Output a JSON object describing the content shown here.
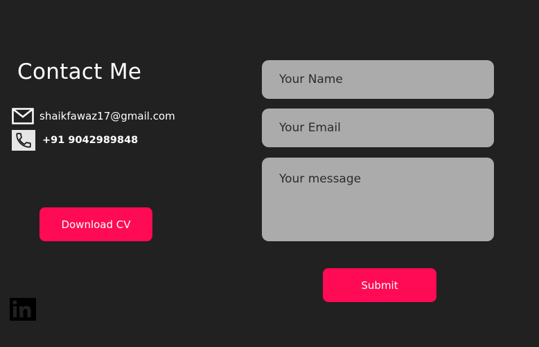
{
  "contact": {
    "title": "Contact Me",
    "email": "shaikfawaz17@gmail.com",
    "phone": "+91 9042989848",
    "download_label": "Download CV"
  },
  "form": {
    "name_placeholder": "Your Name",
    "email_placeholder": "Your Email",
    "message_placeholder": "Your message",
    "submit_label": "Submit"
  },
  "icons": {
    "email": "mail-icon",
    "phone": "phone-icon",
    "social": "linkedin-icon"
  },
  "colors": {
    "background": "#212121",
    "accent": "#ff0a54",
    "field": "#ababab"
  }
}
